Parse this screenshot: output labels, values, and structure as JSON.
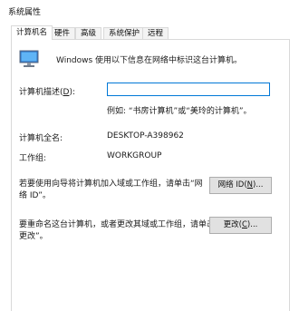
{
  "window": {
    "title": "系统属性"
  },
  "tabs": [
    {
      "label": "计算机名",
      "active": true
    },
    {
      "label": "硬件",
      "active": false
    },
    {
      "label": "高级",
      "active": false
    },
    {
      "label": "系统保护",
      "active": false
    },
    {
      "label": "远程",
      "active": false
    }
  ],
  "intro": {
    "text": "Windows 使用以下信息在网络中标识这台计算机。"
  },
  "description": {
    "label_prefix": "计算机描述(",
    "label_key": "D",
    "label_suffix": "):",
    "value": "",
    "example": "例如: “书房计算机”或“美玲的计算机”。"
  },
  "full_name": {
    "label": "计算机全名:",
    "value": "DESKTOP-A398962"
  },
  "workgroup": {
    "label": "工作组:",
    "value": "WORKGROUP"
  },
  "network_id": {
    "line1": "若要使用向导将计算机加入域或工作组，请单击“网",
    "line2": "络 ID”。",
    "button_prefix": "网络 ID(",
    "button_key": "N",
    "button_suffix": ")..."
  },
  "rename": {
    "line1": "要重命名这台计算机，或者更改其域或工作组，请单击“",
    "line2": "更改”。",
    "button_prefix": "更改(",
    "button_key": "C",
    "button_suffix": ")..."
  }
}
